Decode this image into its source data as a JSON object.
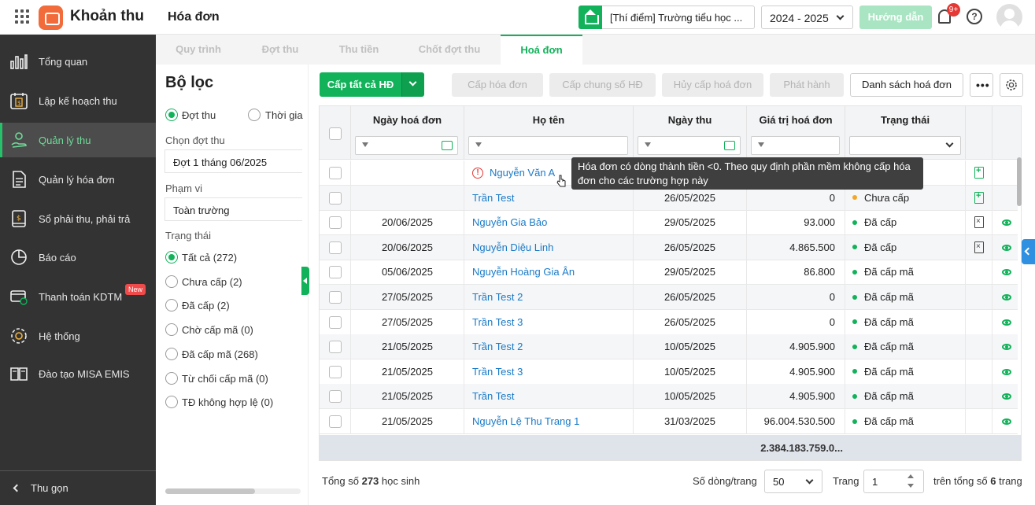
{
  "header": {
    "app_name": "Khoản thu",
    "page_title": "Hóa đơn",
    "school": "[Thí điểm] Trường tiểu học ...",
    "year": "2024 - 2025",
    "guide": "Hướng dẫn",
    "notif_count": "9+"
  },
  "sidebar": {
    "items": [
      {
        "label": "Tổng quan",
        "icon": "chart-bars-icon"
      },
      {
        "label": "Lập kế hoạch thu",
        "icon": "calendar-money-icon"
      },
      {
        "label": "Quản lý thu",
        "icon": "hand-coin-icon"
      },
      {
        "label": "Quản lý hóa đơn",
        "icon": "document-icon"
      },
      {
        "label": "Sổ phải thu, phải trả",
        "icon": "ledger-icon"
      },
      {
        "label": "Báo cáo",
        "icon": "pie-chart-icon"
      },
      {
        "label": "Thanh toán KDTM",
        "icon": "card-payment-icon"
      },
      {
        "label": "Hệ thống",
        "icon": "gear-icon"
      },
      {
        "label": "Đào tạo MISA EMIS",
        "icon": "book-icon"
      }
    ],
    "new_badge": "New",
    "collapse": "Thu gọn"
  },
  "tabs": [
    "Quy trình",
    "Đợt thu",
    "Thu tiền",
    "Chốt đợt thu",
    "Hoá đơn"
  ],
  "filter": {
    "title": "Bộ lọc",
    "mode_1": "Đợt thu",
    "mode_2": "Thời gia",
    "batch_label": "Chọn đợt thu",
    "batch_value": "Đợt 1 tháng 06/2025",
    "scope_label": "Phạm vi",
    "scope_value": "Toàn trường",
    "status_label": "Trạng thái",
    "statuses": [
      "Tất cả (272)",
      "Chưa cấp (2)",
      "Đã cấp (2)",
      "Chờ cấp mã (0)",
      "Đã cấp mã (268)",
      "Từ chối cấp mã (0)",
      "TĐ không hợp lệ (0)"
    ]
  },
  "toolbar": {
    "issue_all": "Cấp tất cả HĐ",
    "issue": "Cấp hóa đơn",
    "issue_common": "Cấp chung số HĐ",
    "cancel": "Hủy cấp hoá đơn",
    "publish": "Phát hành",
    "list": "Danh sách hoá đơn"
  },
  "table": {
    "columns": [
      "Ngày hoá đơn",
      "Họ tên",
      "Ngày thu",
      "Giá trị hoá đơn",
      "Trạng thái"
    ],
    "rows": [
      {
        "invoice_date": "",
        "name": "Nguyễn Văn A",
        "pay_date": "",
        "amount": "",
        "status": "",
        "status_color": "",
        "error": true,
        "action": "add"
      },
      {
        "invoice_date": "",
        "name": "Trần Test",
        "pay_date": "26/05/2025",
        "amount": "0",
        "status": "Chưa cấp",
        "status_color": "#f5a623",
        "error": false,
        "action": "add"
      },
      {
        "invoice_date": "20/06/2025",
        "name": "Nguyễn Gia Bảo",
        "pay_date": "29/05/2025",
        "amount": "93.000",
        "status": "Đã cấp",
        "status_color": "#12b25a",
        "error": false,
        "action": "cancel",
        "view": true
      },
      {
        "invoice_date": "20/06/2025",
        "name": "Nguyễn Diệu Linh",
        "pay_date": "26/05/2025",
        "amount": "4.865.500",
        "status": "Đã cấp",
        "status_color": "#12b25a",
        "error": false,
        "action": "cancel",
        "view": true
      },
      {
        "invoice_date": "05/06/2025",
        "name": "Nguyễn Hoàng Gia Ân",
        "pay_date": "29/05/2025",
        "amount": "86.800",
        "status": "Đã cấp mã",
        "status_color": "#12b25a",
        "error": false,
        "view": true
      },
      {
        "invoice_date": "27/05/2025",
        "name": "Trần Test 2",
        "pay_date": "26/05/2025",
        "amount": "0",
        "status": "Đã cấp mã",
        "status_color": "#12b25a",
        "error": false,
        "view": true
      },
      {
        "invoice_date": "27/05/2025",
        "name": "Trần Test 3",
        "pay_date": "26/05/2025",
        "amount": "0",
        "status": "Đã cấp mã",
        "status_color": "#12b25a",
        "error": false,
        "view": true
      },
      {
        "invoice_date": "21/05/2025",
        "name": "Trần Test 2",
        "pay_date": "10/05/2025",
        "amount": "4.905.900",
        "status": "Đã cấp mã",
        "status_color": "#12b25a",
        "error": false,
        "view": true
      },
      {
        "invoice_date": "21/05/2025",
        "name": "Trần Test 3",
        "pay_date": "10/05/2025",
        "amount": "4.905.900",
        "status": "Đã cấp mã",
        "status_color": "#12b25a",
        "error": false,
        "view": true
      },
      {
        "invoice_date": "21/05/2025",
        "name": "Trần Test",
        "pay_date": "10/05/2025",
        "amount": "4.905.900",
        "status": "Đã cấp mã",
        "status_color": "#12b25a",
        "error": false,
        "view": true
      },
      {
        "invoice_date": "21/05/2025",
        "name": "Nguyễn Lệ Thu Trang 1",
        "pay_date": "31/03/2025",
        "amount": "96.004.530.500",
        "status": "Đã cấp mã",
        "status_color": "#12b25a",
        "error": false,
        "view": true
      }
    ],
    "total": "2.384.183.759.0..."
  },
  "tooltip": "Hóa đơn có dòng thành tiền <0. Theo quy định phần mềm không cấp hóa đơn cho các trường hợp này",
  "footer": {
    "total_prefix": "Tổng số ",
    "total_count": "273",
    "total_suffix": " học sinh",
    "rows_label": "Số dòng/trang",
    "rows_value": "50",
    "page_label": "Trang",
    "page_value": "1",
    "of_prefix": "trên tổng số ",
    "of_count": "6",
    "of_suffix": " trang"
  }
}
